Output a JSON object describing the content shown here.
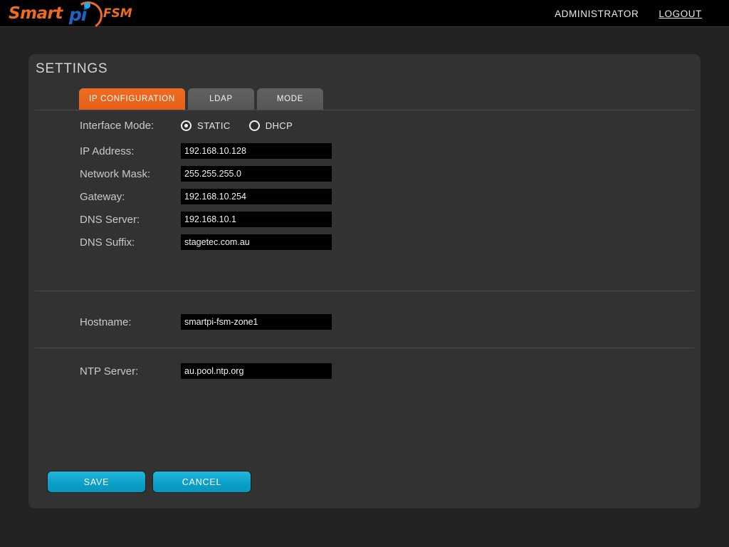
{
  "header": {
    "logo": {
      "smart_text": "Smart",
      "pi_text": "pi",
      "product_text": "FSM",
      "dot_icon": "blue-dot",
      "arc_icon": "orange-swoosh"
    },
    "user_label": "ADMINISTRATOR",
    "logout_label": "LOGOUT"
  },
  "page": {
    "title": "SETTINGS"
  },
  "tabs": [
    {
      "label": "IP CONFIGURATION",
      "active": true
    },
    {
      "label": "LDAP",
      "active": false
    },
    {
      "label": "MODE",
      "active": false
    }
  ],
  "form": {
    "interface_mode": {
      "label": "Interface Mode:",
      "options": [
        {
          "label": "STATIC",
          "selected": true
        },
        {
          "label": "DHCP",
          "selected": false
        }
      ]
    },
    "fields": [
      {
        "label": "IP Address:",
        "value": "192.168.10.128"
      },
      {
        "label": "Network Mask:",
        "value": "255.255.255.0"
      },
      {
        "label": "Gateway:",
        "value": "192.168.10.254"
      },
      {
        "label": "DNS Server:",
        "value": "192.168.10.1"
      },
      {
        "label": "DNS Suffix:",
        "value": "stagetec.com.au"
      }
    ],
    "hostname": {
      "label": "Hostname:",
      "value": "smartpi-fsm-zone1"
    },
    "ntp_server": {
      "label": "NTP Server:",
      "value": "au.pool.ntp.org"
    }
  },
  "actions": {
    "save_label": "SAVE",
    "cancel_label": "CANCEL"
  },
  "colors": {
    "accent_orange": "#ef6c23",
    "accent_blue": "#1b64c8",
    "button_cyan": "#0aa0c8",
    "panel_bg": "#323232",
    "page_bg": "#222222",
    "input_bg": "#000000"
  }
}
